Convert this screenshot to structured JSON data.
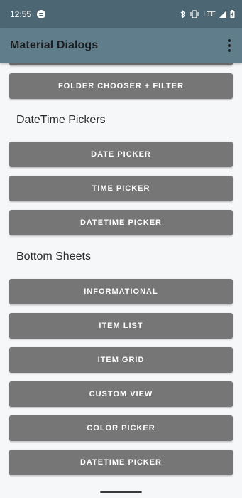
{
  "status": {
    "time": "12:55",
    "network": "LTE"
  },
  "app_bar": {
    "title": "Material Dialogs"
  },
  "sections": {
    "datetime_title": "DateTime Pickers",
    "bottom_sheets_title": "Bottom Sheets"
  },
  "buttons": {
    "folder_chooser_filter": "FOLDER CHOOSER + FILTER",
    "date_picker": "DATE PICKER",
    "time_picker": "TIME PICKER",
    "datetime_picker": "DATETIME PICKER",
    "informational": "INFORMATIONAL",
    "item_list": "ITEM LIST",
    "item_grid": "ITEM GRID",
    "custom_view": "CUSTOM VIEW",
    "color_picker": "COLOR PICKER",
    "datetime_picker_sheet": "DATETIME PICKER"
  },
  "colors": {
    "status_bar": "#4d6673",
    "app_bar": "#607d8b",
    "button": "#767676",
    "background": "#f6f7f9"
  }
}
